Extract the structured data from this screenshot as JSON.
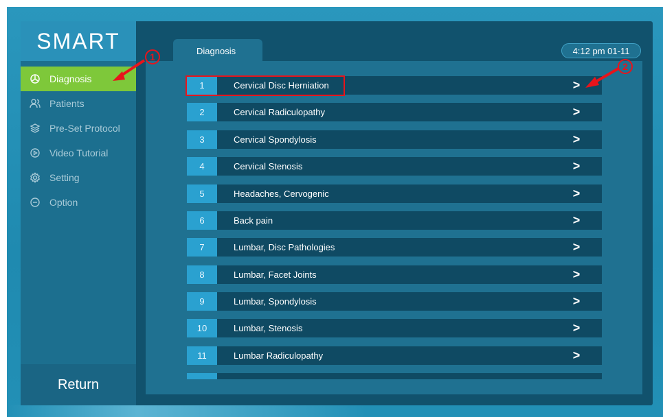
{
  "app": {
    "logo": "SMART",
    "time": "4:12 pm 01-11"
  },
  "sidebar": {
    "items": [
      {
        "label": "Diagnosis",
        "icon": "diagnosis-icon",
        "active": true
      },
      {
        "label": "Patients",
        "icon": "patients-icon",
        "active": false
      },
      {
        "label": "Pre-Set Protocol",
        "icon": "layers-icon",
        "active": false
      },
      {
        "label": "Video Tutorial",
        "icon": "play-icon",
        "active": false
      },
      {
        "label": "Setting",
        "icon": "gear-icon",
        "active": false
      },
      {
        "label": "Option",
        "icon": "option-icon",
        "active": false
      }
    ],
    "return_label": "Return"
  },
  "main": {
    "tab_label": "Diagnosis",
    "rows": [
      {
        "num": "1",
        "label": "Cervical Disc Herniation"
      },
      {
        "num": "2",
        "label": "Cervical Radiculopathy"
      },
      {
        "num": "3",
        "label": "Cervical Spondylosis"
      },
      {
        "num": "4",
        "label": "Cervical Stenosis"
      },
      {
        "num": "5",
        "label": "Headaches, Cervogenic"
      },
      {
        "num": "6",
        "label": "Back pain"
      },
      {
        "num": "7",
        "label": "Lumbar, Disc Pathologies"
      },
      {
        "num": "8",
        "label": "Lumbar, Facet Joints"
      },
      {
        "num": "9",
        "label": "Lumbar, Spondylosis"
      },
      {
        "num": "10",
        "label": "Lumbar, Stenosis"
      },
      {
        "num": "11",
        "label": "Lumbar Radiculopathy"
      }
    ],
    "chevron": ">"
  },
  "annotations": {
    "callout_1": "1",
    "callout_2": "2"
  },
  "colors": {
    "accent_active": "#7ec83a",
    "number_badge": "#2aa1d0",
    "annotation_red": "#e8141b"
  }
}
